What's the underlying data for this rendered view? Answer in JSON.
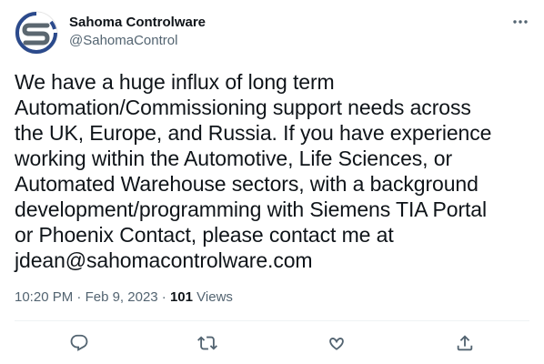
{
  "author": {
    "name": "Sahoma Controlware",
    "handle": "@SahomaControl",
    "avatar_icon": "sahoma-logo"
  },
  "tweet": {
    "text": "We have a huge influx of long term\nAutomation/Commissioning support needs across\nthe UK, Europe, and Russia. If you have experience\nworking within the Automotive, Life Sciences, or\nAutomated Warehouse sectors, with a background\ndevelopment/programming with Siemens TIA Portal\nor Phoenix Contact, please contact me at\njdean@sahomacontrolware.com",
    "time": "10:20 PM",
    "separator": "·",
    "date": "Feb 9, 2023",
    "views_count": "101",
    "views_label": "Views"
  },
  "actions": [
    {
      "icon": "reply-icon"
    },
    {
      "icon": "retweet-icon"
    },
    {
      "icon": "like-icon"
    },
    {
      "icon": "share-icon"
    }
  ],
  "colors": {
    "text": "#0f1419",
    "secondary": "#536471",
    "divider": "#eff3f4",
    "logo_blue": "#2b4a8c",
    "logo_gray": "#5b6770"
  }
}
